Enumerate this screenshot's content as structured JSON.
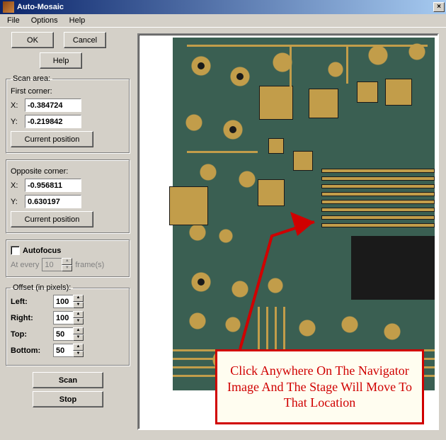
{
  "window": {
    "title": "Auto-Mosaic",
    "close_label": "×"
  },
  "menubar": {
    "file": "File",
    "options": "Options",
    "help": "Help"
  },
  "buttons": {
    "ok": "OK",
    "cancel": "Cancel",
    "help": "Help",
    "current_position": "Current position",
    "scan": "Scan",
    "stop": "Stop"
  },
  "scan_area": {
    "legend": "Scan area:",
    "first_corner_label": "First corner:",
    "opposite_corner_label": "Opposite corner:",
    "x_label": "X:",
    "y_label": "Y:",
    "first": {
      "x": "-0.384724",
      "y": "-0.219842"
    },
    "opposite": {
      "x": "-0.956811",
      "y": "0.630197"
    }
  },
  "autofocus": {
    "label": "Autofocus",
    "every_prefix": "At every",
    "every_value": "10",
    "every_suffix": "frame(s)"
  },
  "offset": {
    "legend": "Offset (in pixels):",
    "left_label": "Left:",
    "right_label": "Right:",
    "top_label": "Top:",
    "bottom_label": "Bottom:",
    "left": "100",
    "right": "100",
    "top": "50",
    "bottom": "50"
  },
  "callout_text": "Click Anywhere On The Navigator Image And The Stage Will Move To That Location"
}
